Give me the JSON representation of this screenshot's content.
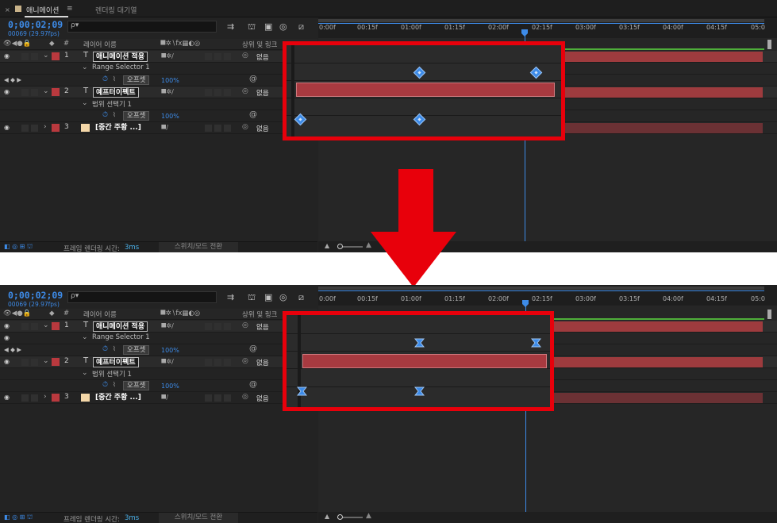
{
  "tabs": {
    "active": "애니메이션",
    "menu": "≡",
    "secondary": "렌더링 대기열",
    "close": "×"
  },
  "header": {
    "timecode": "0;00;02;09",
    "frame_info": "00069 (29.97fps)",
    "search_placeholder": "ρ▾"
  },
  "columns": {
    "layer_name": "레이어 이름",
    "parent": "상위 및 링크",
    "number_sign": "#"
  },
  "layers": [
    {
      "num": "1",
      "type": "T",
      "name": "애니메이션 적용",
      "parent": "없음",
      "color": "#b9393e"
    },
    {
      "sub": "Range Selector 1",
      "prop": "오프셋",
      "value": "100%"
    },
    {
      "num": "2",
      "type": "T",
      "name": "예프터이펙트",
      "parent": "없음",
      "color": "#b9393e"
    },
    {
      "sub": "범위 선택기 1",
      "prop": "오프셋",
      "value": "100%"
    },
    {
      "num": "3",
      "name": "[중간 주황 ...]",
      "parent": "없음",
      "color": "#b9393e",
      "swatch": "#f4d7a8"
    }
  ],
  "ruler": {
    "ticks": [
      "0:00f",
      "00:15f",
      "01:00f",
      "01:15f",
      "02:00f",
      "02:15f",
      "03:00f",
      "03:15f",
      "04:00f",
      "04:15f",
      "05:0"
    ]
  },
  "footer": {
    "frame_label": "프레임 렌더링 시간:",
    "frame_value": "3ms",
    "switch_label": "스위치/모드 전환"
  },
  "icons": {
    "eye": "eye-icon",
    "stopwatch": "stopwatch-icon",
    "spiral": "pickwhip-icon",
    "keyframe_linear": "linear-keyframe-icon",
    "keyframe_ease": "easy-ease-keyframe-icon"
  },
  "colors": {
    "highlight": "#e8000b",
    "accent": "#3d8be8",
    "layer_bar": "#9e3b3e",
    "work_area": "#4eae3a"
  }
}
